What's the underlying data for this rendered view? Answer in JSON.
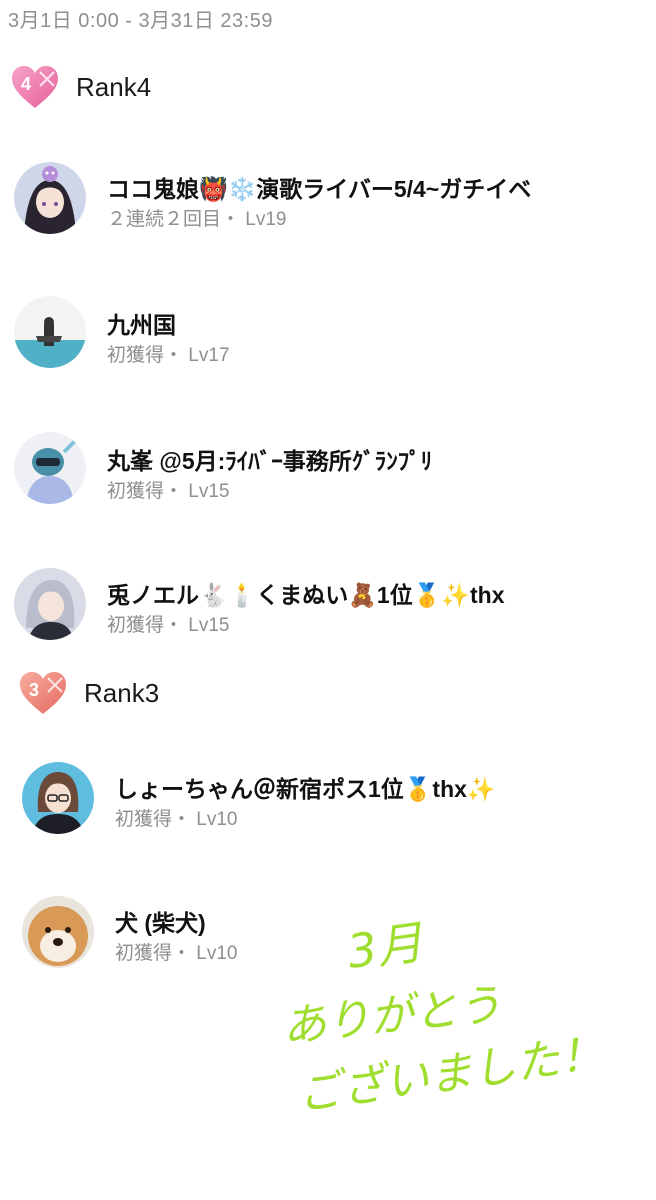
{
  "period": "3月1日 0:00 - 3月31日 23:59",
  "ranks": [
    {
      "label": "Rank4",
      "badge_number": "4",
      "badge_color": "#f07aa8",
      "users": [
        {
          "name": "ココ鬼娘👹❄️演歌ライバー5/4~ガチイベ",
          "meta": "２連続２回目・ Lv19",
          "avatar": "anime-girl-dark-hair"
        },
        {
          "name": "九州国",
          "meta": "初獲得・ Lv17",
          "avatar": "photo-figure"
        },
        {
          "name": "丸峯 @5月:ﾗｲﾊﾞｰ事務所ｸﾞﾗﾝﾌﾟﾘ",
          "meta": "初獲得・ Lv15",
          "avatar": "blue-character"
        },
        {
          "name": "兎ノエル🐇🕯️くまぬい🧸1位🥇✨thx",
          "meta": "初獲得・ Lv15",
          "avatar": "silver-hair-boy"
        }
      ]
    },
    {
      "label": "Rank3",
      "badge_number": "3",
      "badge_color": "#f0847a",
      "users": [
        {
          "name": "しょーちゃん＠新宿ポス1位🥇thx✨",
          "meta": "初獲得・ Lv10",
          "avatar": "brown-hair-boy"
        },
        {
          "name": "犬 (柴犬)",
          "meta": "初獲得・ Lv10",
          "avatar": "shiba-dog"
        }
      ]
    }
  ],
  "handwritten_note": [
    "3月",
    "ありがとう",
    "ございました！"
  ],
  "note_color": "#9fde2e"
}
